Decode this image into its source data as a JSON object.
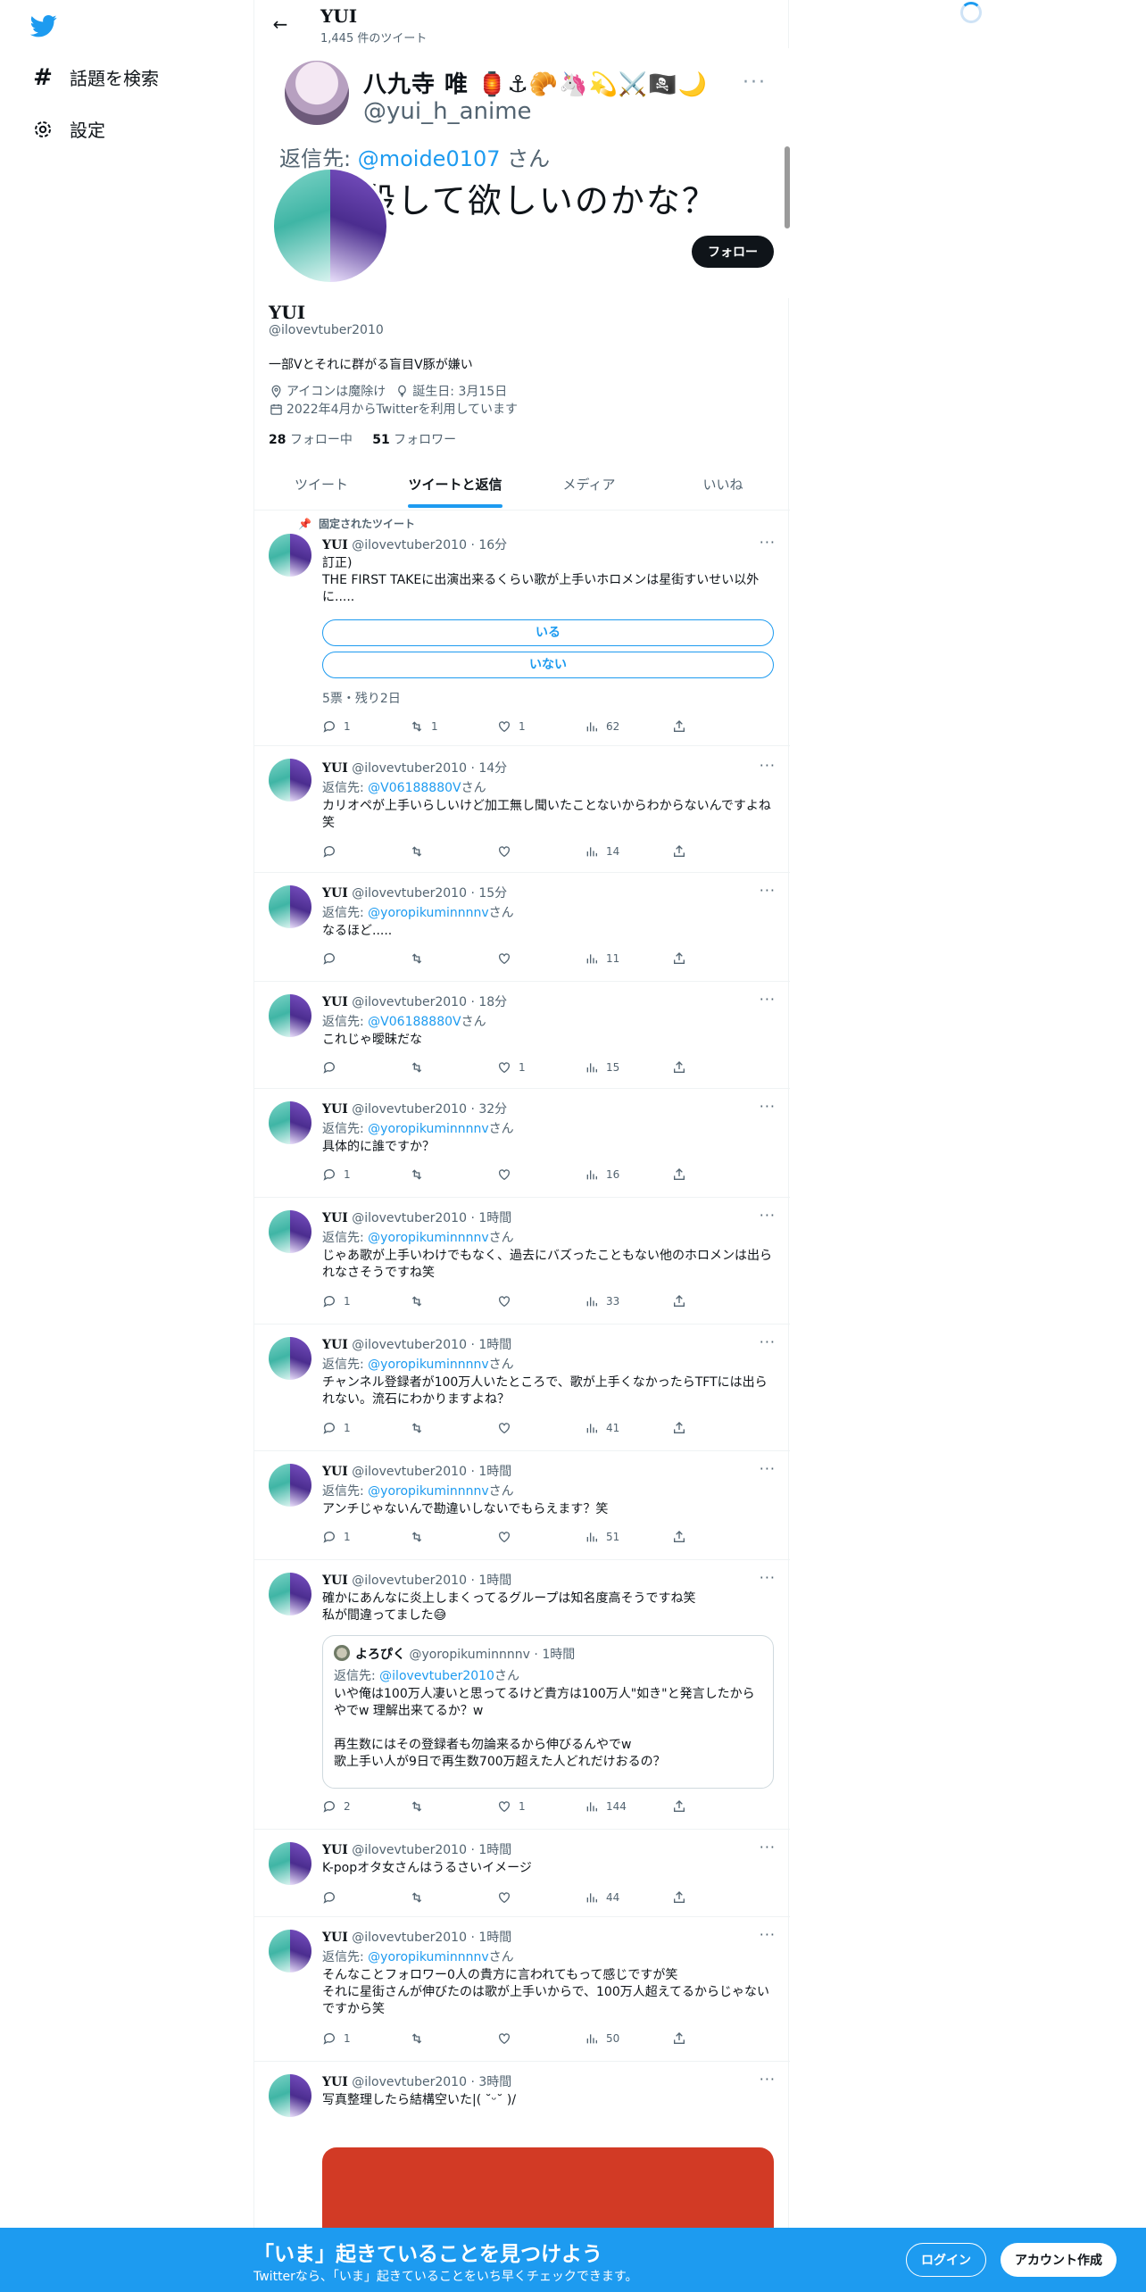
{
  "nav": {
    "explore_label": "話題を検索",
    "settings_label": "設定"
  },
  "header": {
    "name": "YUI",
    "tweet_count": "1,445 件のツイート"
  },
  "banner": {
    "name": "八九寺 唯 🏮⚓🥐🦄💫⚔️🏴‍☠️🌙",
    "handle": "@yui_h_anime",
    "more": "···",
    "reply_prefix": "返信先: ",
    "reply_to": "@moide0107",
    "reply_suffix": " さん",
    "text": "殺して欲しいのかな？"
  },
  "profile": {
    "follow_button": "フォロー",
    "name": "YUI",
    "handle": "@ilovevtuber2010",
    "bio": "一部Vとそれに群がる盲目V豚が嫌い",
    "location": "アイコンは魔除け",
    "birthday": "誕生日: 3月15日",
    "joined": "2022年4月からTwitterを利用しています",
    "following_count": "28",
    "following_label": "フォロー中",
    "followers_count": "51",
    "followers_label": "フォロワー"
  },
  "tabs": [
    {
      "label": "ツイート",
      "active": false
    },
    {
      "label": "ツイートと返信",
      "active": true
    },
    {
      "label": "メディア",
      "active": false
    },
    {
      "label": "いいね",
      "active": false
    }
  ],
  "pinned_label": "固定されたツイート",
  "tweets": [
    {
      "name": "YUI",
      "handle": "@ilovevtuber2010",
      "time": "16分",
      "body": "訂正)\nTHE FIRST TAKEに出演出来るくらい歌が上手いホロメンは星街すいせい以外に.....",
      "poll": {
        "options": [
          "いる",
          "いない"
        ],
        "meta": "5票・残り2日"
      },
      "replies": "1",
      "retweets": "1",
      "likes": "1",
      "views": "62"
    },
    {
      "name": "YUI",
      "handle": "@ilovevtuber2010",
      "time": "14分",
      "reply_to": "@V06188880V",
      "body": "カリオペが上手いらしいけど加工無し聞いたことないからわからないんですよね笑",
      "replies": "",
      "retweets": "",
      "likes": "",
      "views": "14"
    },
    {
      "name": "YUI",
      "handle": "@ilovevtuber2010",
      "time": "15分",
      "reply_to": "@yoropikuminnnnv",
      "body": "なるほど.....",
      "replies": "",
      "retweets": "",
      "likes": "",
      "views": "11"
    },
    {
      "name": "YUI",
      "handle": "@ilovevtuber2010",
      "time": "18分",
      "reply_to": "@V06188880V",
      "body": "これじゃ曖昧だな",
      "replies": "",
      "retweets": "",
      "likes": "1",
      "views": "15"
    },
    {
      "name": "YUI",
      "handle": "@ilovevtuber2010",
      "time": "32分",
      "reply_to": "@yoropikuminnnnv",
      "body": "具体的に誰ですか？",
      "replies": "1",
      "retweets": "",
      "likes": "",
      "views": "16"
    },
    {
      "name": "YUI",
      "handle": "@ilovevtuber2010",
      "time": "1時間",
      "reply_to": "@yoropikuminnnnv",
      "body": "じゃあ歌が上手いわけでもなく、過去にバズったこともない他のホロメンは出られなさそうですね笑",
      "replies": "1",
      "retweets": "",
      "likes": "",
      "views": "33"
    },
    {
      "name": "YUI",
      "handle": "@ilovevtuber2010",
      "time": "1時間",
      "reply_to": "@yoropikuminnnnv",
      "body": "チャンネル登録者が100万人いたところで、歌が上手くなかったらTFTには出られない。流石にわかりますよね？",
      "replies": "1",
      "retweets": "",
      "likes": "",
      "views": "41"
    },
    {
      "name": "YUI",
      "handle": "@ilovevtuber2010",
      "time": "1時間",
      "reply_to": "@yoropikuminnnnv",
      "body": "アンチじゃないんで勘違いしないでもらえます？笑",
      "replies": "1",
      "retweets": "",
      "likes": "",
      "views": "51"
    },
    {
      "name": "YUI",
      "handle": "@ilovevtuber2010",
      "time": "1時間",
      "body": "確かにあんなに炎上しまくってるグループは知名度高そうですね笑\n私が間違ってました😅",
      "quote": {
        "name": "よろぴく",
        "handle": "@yoropikuminnnnv",
        "time": "1時間",
        "reply_to": "@ilovevtuber2010",
        "body": "いや俺は100万人凄いと思ってるけど貴方は100万人\"如き\"と発言したからやでw 理解出来てるか？w\n\n再生数にはその登録者も勿論来るから伸びるんやでw\n歌上手い人が9日で再生数700万超えた人どれだけおるの？"
      },
      "replies": "2",
      "retweets": "",
      "likes": "1",
      "views": "144"
    },
    {
      "name": "YUI",
      "handle": "@ilovevtuber2010",
      "time": "1時間",
      "body": "K-popオタ女さんはうるさいイメージ",
      "replies": "",
      "retweets": "",
      "likes": "",
      "views": "44"
    },
    {
      "name": "YUI",
      "handle": "@ilovevtuber2010",
      "time": "1時間",
      "reply_to": "@yoropikuminnnnv",
      "body": "そんなことフォロワー0人の貴方に言われてもって感じですが笑\nそれに星街さんが伸びたのは歌が上手いからで、100万人超えてるからじゃないですから笑",
      "replies": "1",
      "retweets": "",
      "likes": "",
      "views": "50"
    },
    {
      "name": "YUI",
      "handle": "@ilovevtuber2010",
      "time": "3時間",
      "body": "写真整理したら結構空いた|( ˘ᵕ˘ )/"
    }
  ],
  "reply_prefix": "返信先: ",
  "reply_suffix": "さん",
  "more_glyph": "···",
  "bottom": {
    "title": "「いま」起きていることを見つけよう",
    "subtitle": "Twitterなら、「いま」起きていることをいち早くチェックできます。",
    "login": "ログイン",
    "signup": "アカウント作成"
  },
  "colors": {
    "accent": "#1d9bf0",
    "text": "#0f1419",
    "muted": "#536471"
  }
}
